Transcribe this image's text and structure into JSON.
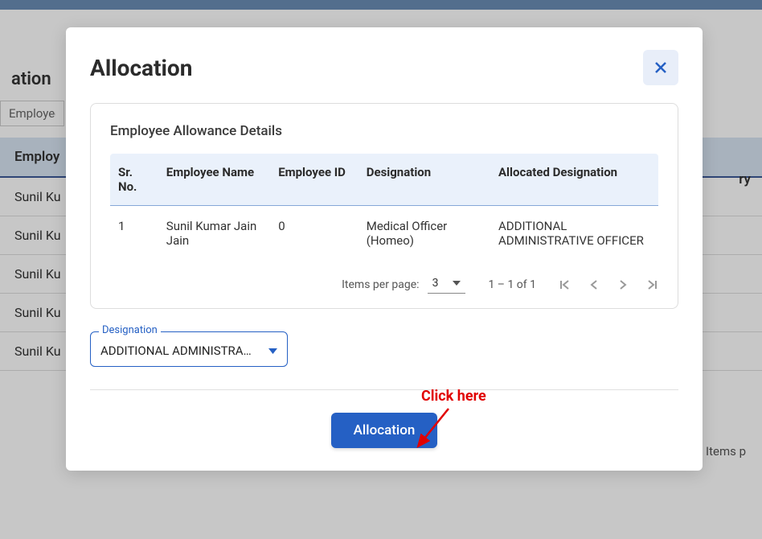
{
  "background": {
    "title_fragment": "ation",
    "input_value": "Employee",
    "col_employee": "Employ",
    "col_right": "ry",
    "rows": [
      "Sunil Ku",
      "Sunil Ku",
      "Sunil Ku",
      "Sunil Ku",
      "Sunil Ku"
    ],
    "items_label": "Items p"
  },
  "modal": {
    "title": "Allocation",
    "card_title": "Employee Allowance Details",
    "columns": {
      "sr": "Sr. No.",
      "name": "Employee Name",
      "id": "Employee ID",
      "designation": "Designation",
      "allocated": "Allocated Designation"
    },
    "rows": [
      {
        "sr": "1",
        "name": "Sunil Kumar Jain Jain",
        "id": "0",
        "designation": "Medical Officer (Homeo)",
        "allocated": "ADDITIONAL ADMINISTRATIVE OFFICER"
      }
    ],
    "paginator": {
      "ipp_label": "Items per page:",
      "ipp_value": "3",
      "range": "1 – 1 of 1"
    },
    "designation_select": {
      "label": "Designation",
      "value": "ADDITIONAL ADMINISTRA…"
    },
    "action_button": "Allocation"
  },
  "annotation": {
    "text": "Click here"
  }
}
